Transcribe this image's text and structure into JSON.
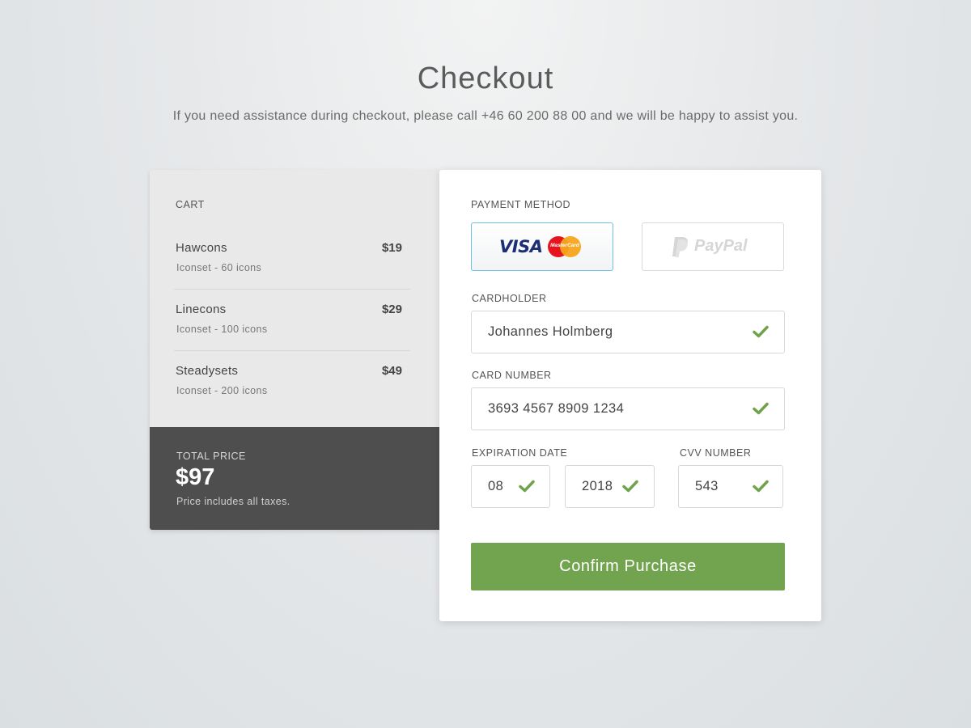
{
  "header": {
    "title": "Checkout",
    "subtitle": "If you need assistance during checkout, please call +46 60 200 88 00 and we will be happy to assist you."
  },
  "cart": {
    "label": "CART",
    "items": [
      {
        "name": "Hawcons",
        "description": "Iconset - 60 icons",
        "price": "$19"
      },
      {
        "name": "Linecons",
        "description": "Iconset - 100 icons",
        "price": "$29"
      },
      {
        "name": "Steadysets",
        "description": "Iconset - 200 icons",
        "price": "$49"
      }
    ],
    "total": {
      "label": "TOTAL PRICE",
      "value": "$97",
      "note": "Price includes all taxes."
    }
  },
  "payment": {
    "label": "PAYMENT METHOD",
    "methods": [
      {
        "name": "VISA",
        "secondary": "MasterCard",
        "selected": true
      },
      {
        "name": "PayPal",
        "selected": false
      }
    ],
    "cardholder": {
      "label": "CARDHOLDER",
      "value": "Johannes Holmberg",
      "valid": true
    },
    "card_number": {
      "label": "CARD NUMBER",
      "value": "3693 4567 8909 1234",
      "valid": true
    },
    "expiration": {
      "label": "EXPIRATION DATE",
      "month": "08",
      "year": "2018",
      "valid": true
    },
    "cvv": {
      "label": "CVV NUMBER",
      "value": "543",
      "valid": true
    },
    "confirm_label": "Confirm Purchase"
  },
  "colors": {
    "accent_green": "#72a44f",
    "check_green": "#6fa24b",
    "selected_border": "#6cc1de",
    "total_bg": "#4e4e4e",
    "cart_bg": "#e9e9e9",
    "visa_blue": "#1c2f74"
  }
}
